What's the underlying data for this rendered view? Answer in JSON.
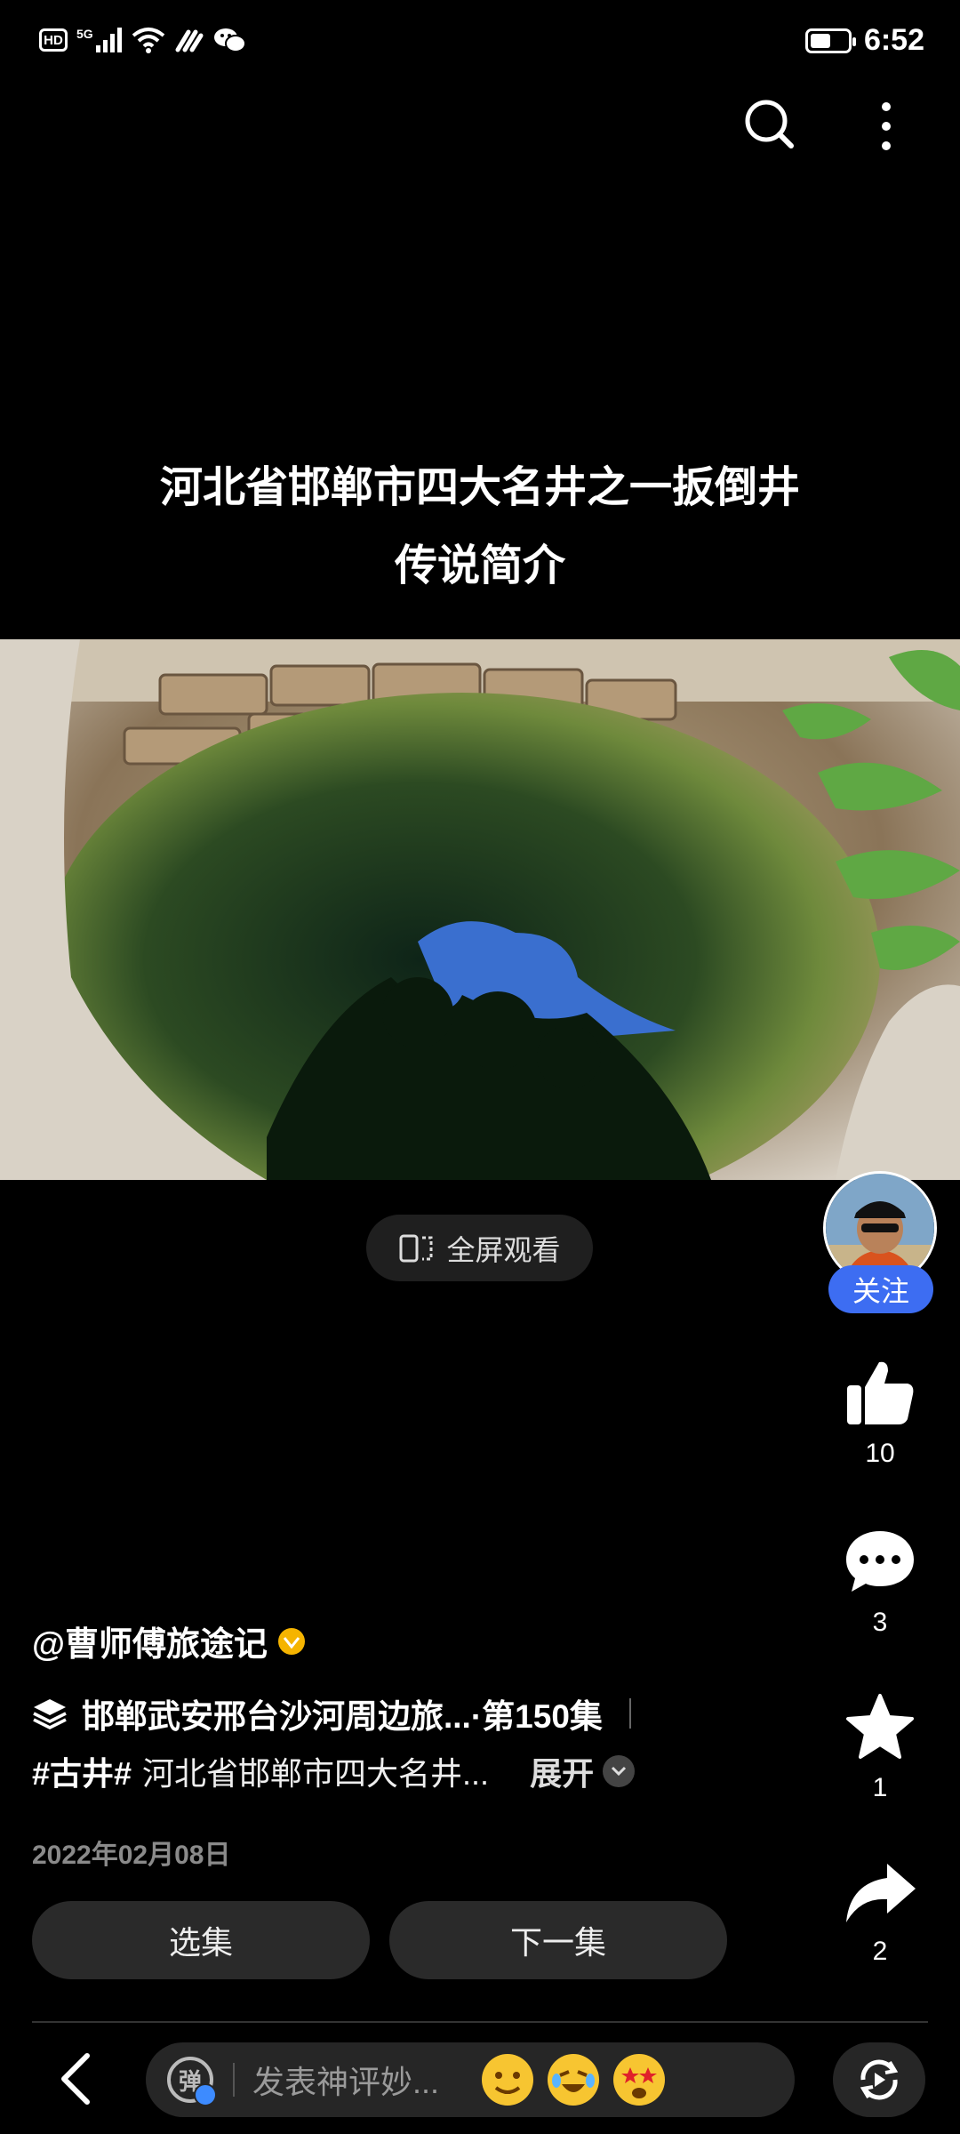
{
  "status_bar": {
    "hd_label": "HD",
    "network_label": "5G",
    "time": "6:52",
    "battery_level": 0.55,
    "icons": [
      "hd-icon",
      "signal-icon",
      "wifi-icon",
      "data-saver-icon",
      "wechat-icon",
      "battery-icon"
    ]
  },
  "top_actions": {
    "search_icon": "search-icon",
    "more_icon": "more-vertical-icon"
  },
  "video": {
    "title_lines": [
      "河北省邯郸市四大名井之一扳倒井",
      "传说简介"
    ],
    "fullscreen_label": "全屏观看"
  },
  "creator": {
    "follow_label": "关注",
    "name": "@曹师傅旅途记"
  },
  "stats": {
    "likes": "10",
    "comments": "3",
    "favorites": "1",
    "shares": "2"
  },
  "collection": {
    "label": "邯郸武安邢台沙河周边旅...·第150集"
  },
  "description": {
    "hashtag": "#古井#",
    "text": "河北省邯郸市四大名井...",
    "expand_label": "展开"
  },
  "post_date": "2022年02月08日",
  "buttons": {
    "episodes_label": "选集",
    "next_label": "下一集"
  },
  "comment_bar": {
    "danmu_label": "弹",
    "placeholder": "发表神评妙..."
  },
  "colors": {
    "background": "#000000",
    "follow_blue": "#3d6df2",
    "verified_gold": "#f5b400"
  }
}
